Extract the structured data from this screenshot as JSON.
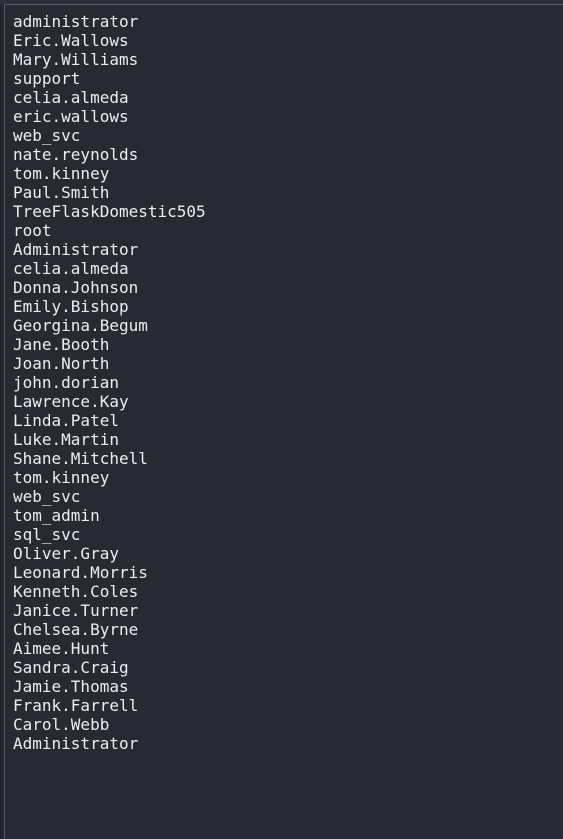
{
  "editor": {
    "lines": [
      "administrator",
      "Eric.Wallows",
      "Mary.Williams",
      "support",
      "celia.almeda",
      "eric.wallows",
      "web_svc",
      "nate.reynolds",
      "tom.kinney",
      "Paul.Smith",
      "TreeFlaskDomestic505",
      "root",
      "Administrator",
      "celia.almeda",
      "Donna.Johnson",
      "Emily.Bishop",
      "Georgina.Begum",
      "Jane.Booth",
      "Joan.North",
      "john.dorian",
      "Lawrence.Kay",
      "Linda.Patel",
      "Luke.Martin",
      "Shane.Mitchell",
      "tom.kinney",
      "web_svc",
      "tom_admin",
      "sql_svc",
      "Oliver.Gray",
      "Leonard.Morris",
      "Kenneth.Coles",
      "Janice.Turner",
      "Chelsea.Byrne",
      "Aimee.Hunt",
      "Sandra.Craig",
      "Jamie.Thomas",
      "Frank.Farrell",
      "Carol.Webb",
      "Administrator"
    ]
  },
  "colors": {
    "background": "#282a33",
    "text": "#eceef2",
    "border": "#5a5d66"
  }
}
